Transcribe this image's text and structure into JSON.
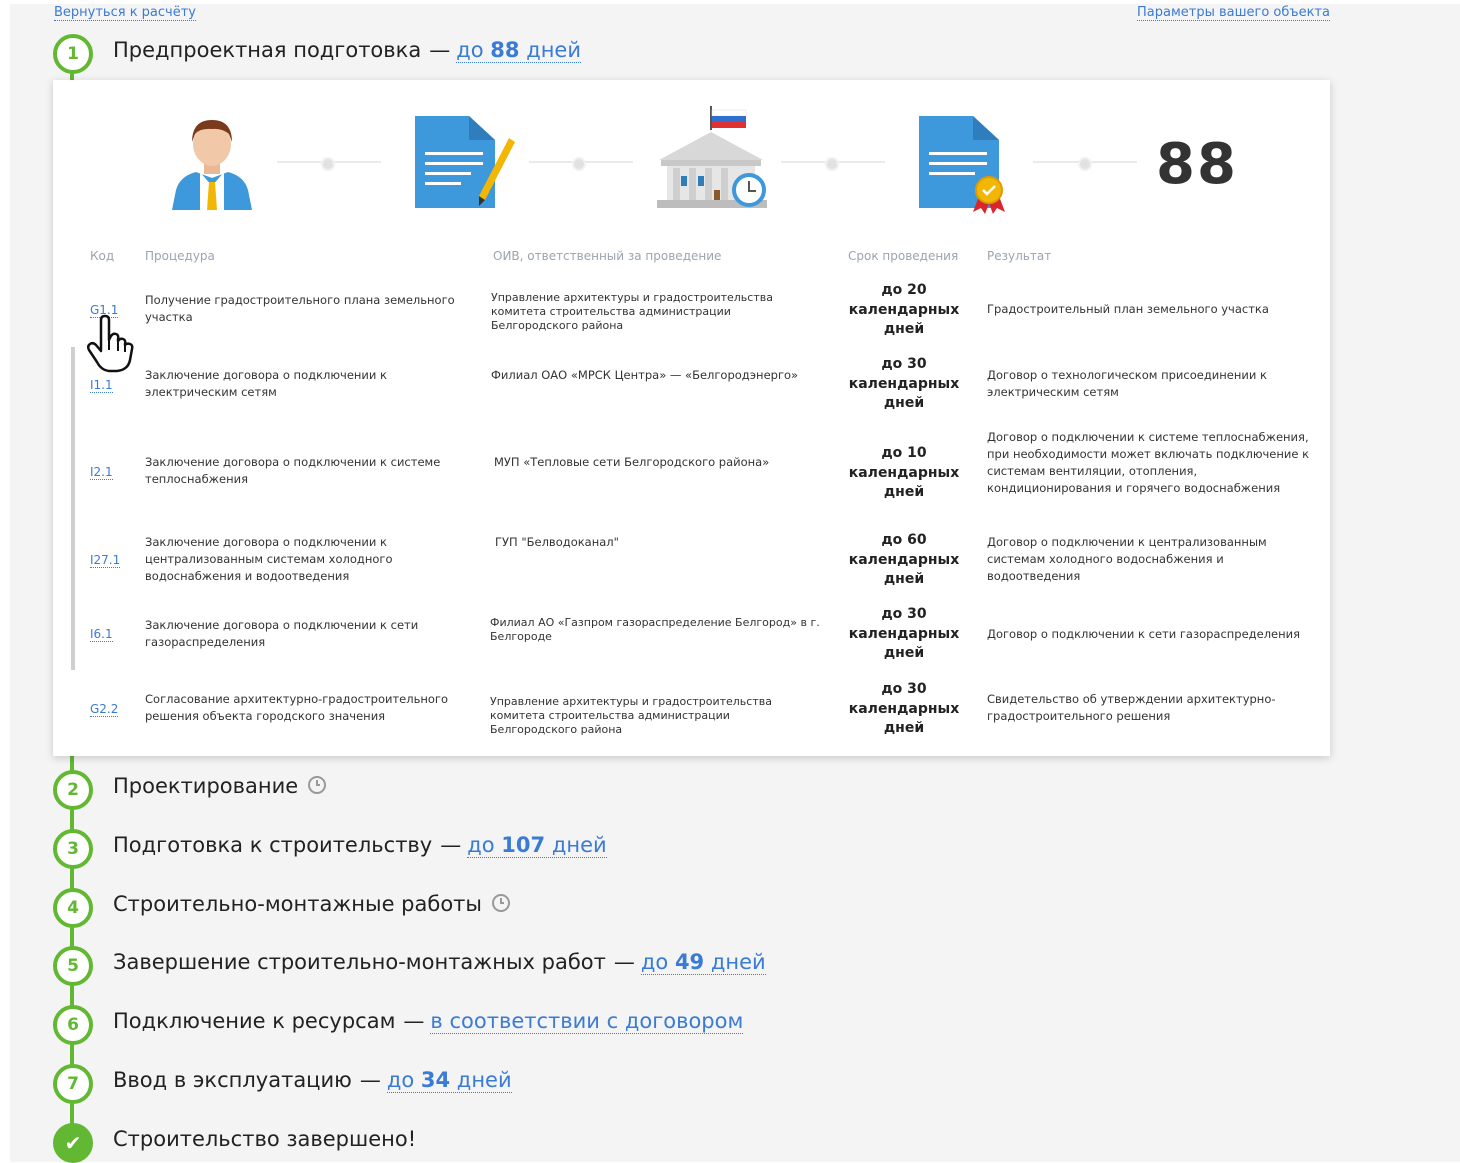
{
  "top": {
    "back_link": "Вернуться к расчёту",
    "params_link": "Параметры вашего объекта"
  },
  "steps": [
    {
      "num": "1",
      "title": "Предпроектная подготовка",
      "dash": "—",
      "link_pre": "до",
      "link_num": "88",
      "link_post": "дней"
    },
    {
      "num": "2",
      "title": "Проектирование"
    },
    {
      "num": "3",
      "title": "Подготовка к строительству",
      "dash": "—",
      "link_pre": "до",
      "link_num": "107",
      "link_post": "дней"
    },
    {
      "num": "4",
      "title": "Строительно-монтажные работы"
    },
    {
      "num": "5",
      "title": "Завершение строительно-монтажных работ",
      "dash": "—",
      "link_pre": "до",
      "link_num": "49",
      "link_post": "дней"
    },
    {
      "num": "6",
      "title": "Подключение к ресурсам",
      "dash": "—",
      "link_text": "в соответствии с договором"
    },
    {
      "num": "7",
      "title": "Ввод в эксплуатацию",
      "dash": "—",
      "link_pre": "до",
      "link_num": "34",
      "link_post": "дней"
    },
    {
      "num": "✔",
      "title": "Строительство завершено!"
    }
  ],
  "panel": {
    "total_days": "88",
    "icons": [
      "person-icon",
      "document-edit-icon",
      "government-building-icon",
      "certificate-document-icon"
    ],
    "headers": {
      "code": "Код",
      "procedure": "Процедура",
      "authority": "ОИВ, ответственный за проведение",
      "term": "Срок проведения",
      "result": "Результат"
    },
    "rows": [
      {
        "code": "G1.1",
        "procedure": "Получение градостроительного плана земельного участка",
        "authority": "Управление архитектуры и градостроительства комитета строительства администрации Белгородского района",
        "term": [
          "до 20",
          "календарных",
          "дней"
        ],
        "result": "Градостроительный план земельного участка"
      },
      {
        "code": "I1.1",
        "procedure": "Заключение договора о подключении к электрическим сетям",
        "authority": "Филиал ОАО «МРСК Центра» — «Белгородэнерго»",
        "term": [
          "до 30",
          "календарных",
          "дней"
        ],
        "result": "Договор о технологическом присоединении к электрическим сетям"
      },
      {
        "code": "I2.1",
        "procedure": "Заключение договора о подключении к системе теплоснабжения",
        "authority": "МУП «Тепловые сети Белгородского района»",
        "term": [
          "до 10",
          "календарных",
          "дней"
        ],
        "result": "Договор о подключении к системе теплоснабжения, при необходимости может включать подключение к системам вентиляции, отопления, кондиционирования и горячего водоснабжения"
      },
      {
        "code": "I27.1",
        "procedure": "Заключение договора о подключении к централизованным системам холодного водоснабжения и водоотведения",
        "authority": "ГУП \"Белводоканал\"",
        "term": [
          "до 60",
          "календарных",
          "дней"
        ],
        "result": "Договор о подключении к централизованным системам холодного водоснабжения и водоотведения"
      },
      {
        "code": "I6.1",
        "procedure": "Заключение договора о подключении к сети газораспределения",
        "authority": "Филиал АО «Газпром газораспределение Белгород» в г. Белгороде",
        "term": [
          "до 30",
          "календарных",
          "дней"
        ],
        "result": "Договор о подключении к сети газораспределения"
      },
      {
        "code": "G2.2",
        "procedure": "Согласование архитектурно-градостроительного решения объекта городского значения",
        "authority": "Управление архитектуры и градостроительства комитета строительства администрации Белгородского района",
        "term": [
          "до 30",
          "календарных",
          "дней"
        ],
        "result": "Свидетельство об утверждении архитектурно-градостроительного решения"
      }
    ]
  },
  "colors": {
    "accent_green": "#62b832",
    "link_blue": "#3a7bd5",
    "icon_blue": "#3d98dc"
  }
}
